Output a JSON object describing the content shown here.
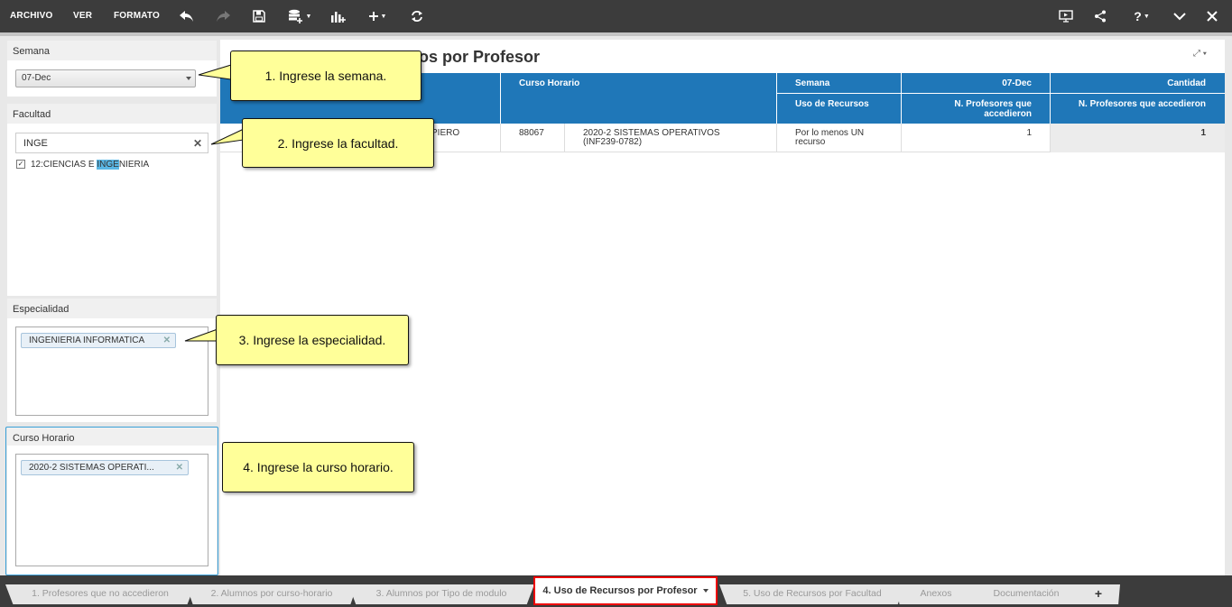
{
  "toolbar": {
    "menus": [
      "ARCHIVO",
      "VER",
      "FORMATO"
    ]
  },
  "filters": {
    "semana": {
      "label": "Semana",
      "selected": "07-Dec"
    },
    "facultad": {
      "label": "Facultad",
      "search": "INGE",
      "item_prefix": "12:CIENCIAS E ",
      "item_highlight": "INGE",
      "item_suffix": "NIERIA"
    },
    "especialidad": {
      "label": "Especialidad",
      "tag": "INGENIERIA INFORMATICA"
    },
    "curso": {
      "label": "Curso Horario",
      "tag": "2020-2 SISTEMAS OPERATI..."
    }
  },
  "main": {
    "title": "os por Profesor",
    "headers": {
      "curso_horario": "Curso Horario",
      "semana": "Semana",
      "semana_value": "07-Dec",
      "cantidad": "Cantidad",
      "uso_recursos": "Uso de Recursos",
      "n_prof_1": "N. Profesores que accedieron",
      "n_prof_2": "N. Profesores que accedieron"
    },
    "row": {
      "profesor": "PIERO",
      "codigo": "88067",
      "curso_line1": "2020-2 SISTEMAS OPERATIVOS",
      "curso_line2": "(INF239-0782)",
      "uso_line1": "Por lo menos UN",
      "uso_line2": "recurso",
      "n_prof": "1",
      "cantidad": "1"
    }
  },
  "callouts": [
    "1. Ingrese la semana.",
    "2. Ingrese la facultad.",
    "3. Ingrese la especialidad.",
    "4. Ingrese la curso horario."
  ],
  "tabs": [
    "1. Profesores que no accedieron",
    "2. Alumnos por curso-horario",
    "3. Alumnos por Tipo de modulo",
    "4. Uso de Recursos por Profesor",
    "5. Uso de Recursos por Facultad",
    "Anexos",
    "Documentación",
    "+"
  ]
}
